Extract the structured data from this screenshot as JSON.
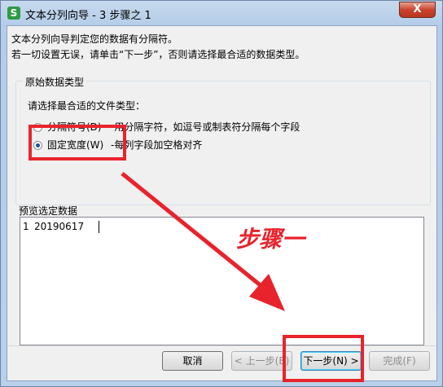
{
  "window": {
    "title": "文本分列向导 - 3 步骤之 1",
    "app_icon": "S",
    "close_label": "X"
  },
  "intro": {
    "line1": "文本分列向导判定您的数据有分隔符。",
    "line2": "若一切设置无误，请单击“下一步”，否则请选择最合适的数据类型。"
  },
  "group": {
    "title": "原始数据类型",
    "prompt": "请选择最合适的文件类型：",
    "options": [
      {
        "label": "分隔符号(D)",
        "desc": "-用分隔字符，如逗号或制表符分隔每个字段",
        "selected": false
      },
      {
        "label": "固定宽度(W)",
        "desc": "-每列字段加空格对齐",
        "selected": true
      }
    ]
  },
  "preview": {
    "label": "预览选定数据",
    "rows": [
      {
        "num": "1",
        "value": "20190617"
      }
    ]
  },
  "buttons": {
    "cancel": "取消",
    "back": "< 上一步(B)",
    "next": "下一步(N) >",
    "finish": "完成(F)"
  },
  "annotation": {
    "text": "步骤一",
    "color": "#e8232c"
  }
}
